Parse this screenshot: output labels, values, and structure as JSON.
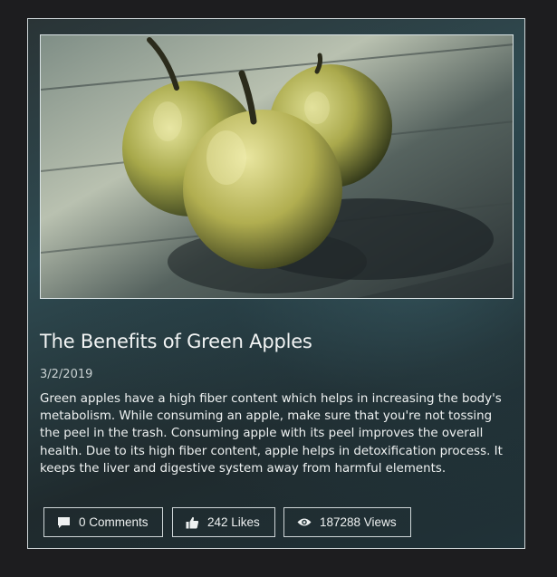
{
  "post": {
    "title": "The Benefits of Green Apples",
    "date": "3/2/2019",
    "body": "Green apples have a high fiber content which helps in increasing the body's metabolism. While consuming an apple, make sure that you're not tossing the peel in the trash. Consuming apple with its peel improves the overall health. Due to its high fiber content, apple helps in detoxification process. It keeps the liver and digestive system away from harmful elements.",
    "image_subject": "three green apples on a wooden table"
  },
  "actions": {
    "comments_label": "0 Comments",
    "likes_label": "242 Likes",
    "views_label": "187288 Views"
  },
  "icons": {
    "comments": "comment-icon",
    "likes": "thumbs-up-icon",
    "views": "eye-icon"
  },
  "colors": {
    "page_background": "#1d1d1f",
    "card_background": "#2f4b52",
    "border": "#cfd6d8",
    "text": "#eef1f1",
    "apple_green": "#b8b65a"
  }
}
